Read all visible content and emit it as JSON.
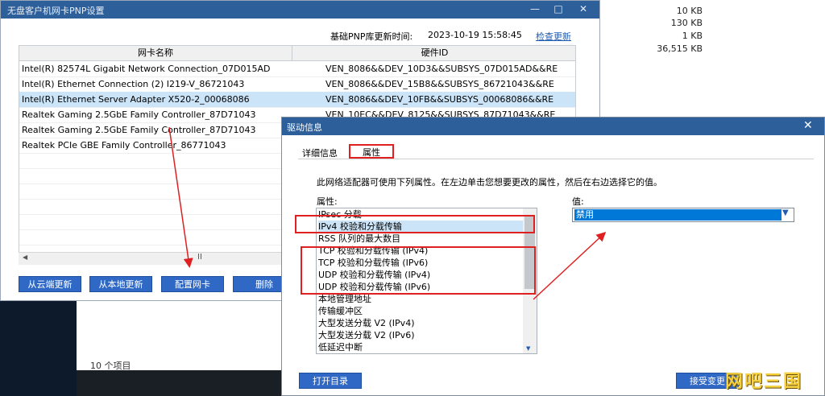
{
  "explorer": {
    "sizes": [
      "10 KB",
      "130 KB",
      "1 KB",
      "36,515 KB"
    ],
    "items_count": "10 个项目"
  },
  "main_window": {
    "title": "无盘客户机网卡PNP设置",
    "pnp_label": "基础PNP库更新时间:",
    "pnp_time": "2023-10-19 15:58:45",
    "check_update": "检查更新",
    "columns": [
      "网卡名称",
      "硬件ID"
    ],
    "rows": [
      {
        "name": "Intel(R) 82574L Gigabit Network Connection_07D015AD",
        "hwid": "VEN_8086&&DEV_10D3&&SUBSYS_07D015AD&&RE"
      },
      {
        "name": "Intel(R) Ethernet Connection (2) I219-V_86721043",
        "hwid": "VEN_8086&&DEV_15B8&&SUBSYS_86721043&&RE"
      },
      {
        "name": "Intel(R) Ethernet Server Adapter X520-2_00068086",
        "hwid": "VEN_8086&&DEV_10FB&&SUBSYS_00068086&&RE"
      },
      {
        "name": "Realtek Gaming 2.5GbE Family Controller_87D71043",
        "hwid": "VEN_10EC&&DEV_8125&&SUBSYS_87D71043&&RE"
      },
      {
        "name": "Realtek Gaming 2.5GbE Family Controller_87D71043",
        "hwid": ""
      },
      {
        "name": "Realtek PCIe GBE Family Controller_86771043",
        "hwid": ""
      }
    ],
    "selected_row": 2,
    "scroll_mid": "II",
    "buttons": {
      "cloud_update": "从云端更新",
      "local_update": "从本地更新",
      "config_nic": "配置网卡",
      "delete": "删除"
    }
  },
  "dialog": {
    "title": "驱动信息",
    "tabs": [
      "详细信息",
      "属性"
    ],
    "active_tab": "属性",
    "description": "此网络适配器可使用下列属性。在左边单击您想要更改的属性，然后在右边选择它的值。",
    "props_label": "属性:",
    "value_label": "值:",
    "properties": [
      "IPsec 分载",
      "IPv4 校验和分载传输",
      "RSS 队列的最大数目",
      "TCP 校验和分载传输 (IPv4)",
      "TCP 校验和分载传输 (IPv6)",
      "UDP 校验和分载传输 (IPv4)",
      "UDP 校验和分载传输 (IPv6)",
      "本地管理地址",
      "传输缓冲区",
      "大型发送分载 V2 (IPv4)",
      "大型发送分载 V2 (IPv6)",
      "低延迟中断"
    ],
    "selected_property": 1,
    "value": "禁用",
    "open_dir": "打开目录",
    "accept": "接受变更"
  },
  "watermark": "网吧三国",
  "colors": {
    "titlebar": "#2d5f9b",
    "button": "#2f69c5",
    "selection": "#cce4f7",
    "highlight_red": "#e02020"
  }
}
